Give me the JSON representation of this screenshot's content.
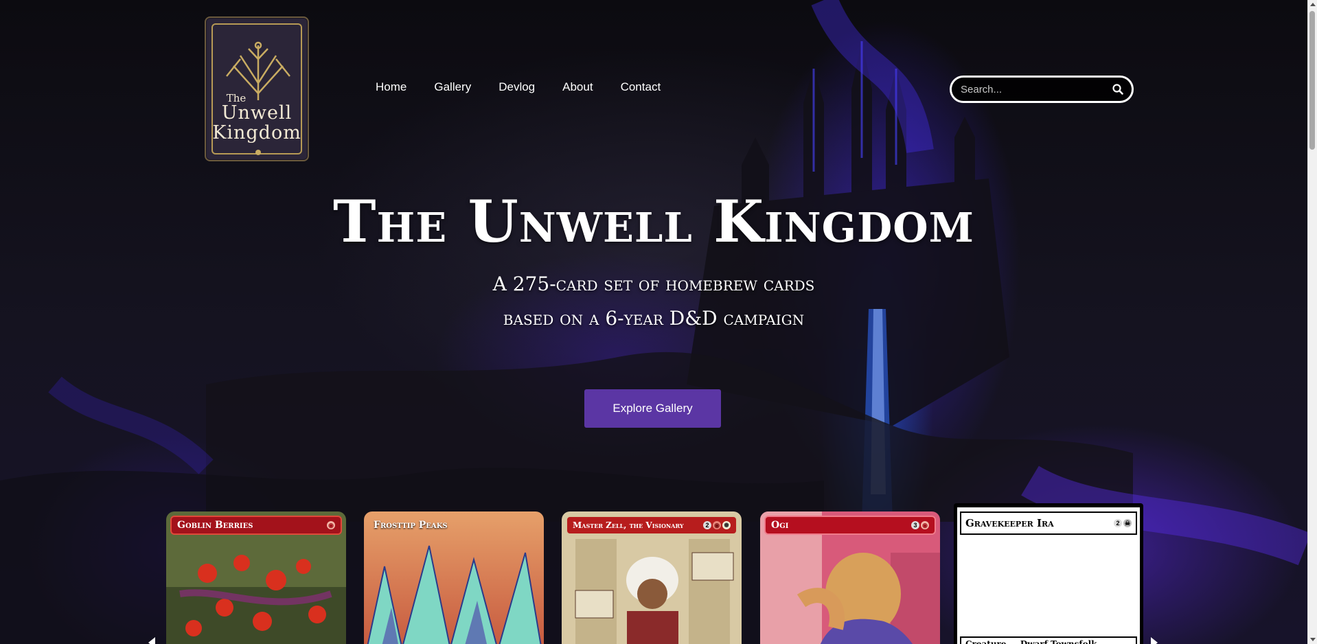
{
  "logo": {
    "line1": "The",
    "line2": "Unwell",
    "line3": "Kingdom"
  },
  "nav": {
    "items": [
      "Home",
      "Gallery",
      "Devlog",
      "About",
      "Contact"
    ]
  },
  "search": {
    "placeholder": "Search..."
  },
  "hero": {
    "title": "The Unwell Kingdom",
    "subtitle_line1": "A 275-card set of homebrew cards",
    "subtitle_line2": "based on a 6-year D&D campaign",
    "cta_label": "Explore Gallery"
  },
  "cards": [
    {
      "name": "Goblin Berries",
      "cost": ""
    },
    {
      "name": "Frosttip Peaks",
      "cost": ""
    },
    {
      "name": "Master Zell, the Visionary",
      "cost": "2"
    },
    {
      "name": "Ogi",
      "cost": "3"
    },
    {
      "name": "Gravekeeper Ira",
      "cost": "2",
      "type_line": "Creature — Dwarf Townsfolk"
    }
  ],
  "colors": {
    "accent": "#5b36a4",
    "red_frame": "#a3121b",
    "blue_glow": "#3a2cff"
  }
}
